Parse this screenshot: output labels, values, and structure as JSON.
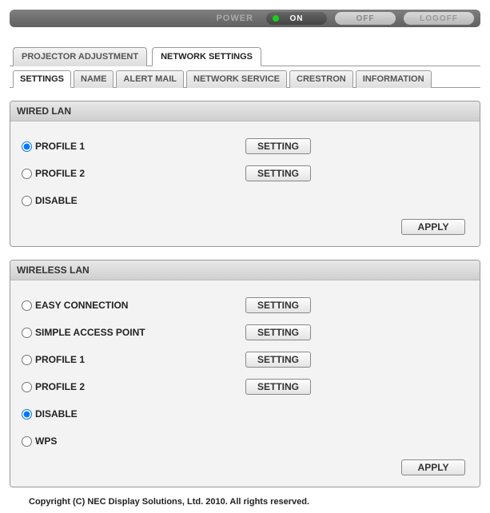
{
  "topbar": {
    "power_label": "POWER",
    "on_label": "ON",
    "off_label": "OFF",
    "logoff_label": "LOGOFF"
  },
  "main_tabs": {
    "projector_adjustment": "PROJECTOR ADJUSTMENT",
    "network_settings": "NETWORK SETTINGS"
  },
  "sub_tabs": {
    "settings": "SETTINGS",
    "name": "NAME",
    "alert_mail": "ALERT MAIL",
    "network_service": "NETWORK SERVICE",
    "crestron": "CRESTRON",
    "information": "INFORMATION"
  },
  "buttons": {
    "setting": "SETTING",
    "apply": "APPLY"
  },
  "wired_lan": {
    "title": "WIRED LAN",
    "options": {
      "profile1": "PROFILE 1",
      "profile2": "PROFILE 2",
      "disable": "DISABLE"
    },
    "selected": "profile1"
  },
  "wireless_lan": {
    "title": "WIRELESS LAN",
    "options": {
      "easy_connection": "EASY CONNECTION",
      "simple_access_point": "SIMPLE ACCESS POINT",
      "profile1": "PROFILE 1",
      "profile2": "PROFILE 2",
      "disable": "DISABLE",
      "wps": "WPS"
    },
    "selected": "disable"
  },
  "footer": "Copyright (C) NEC Display Solutions, Ltd. 2010. All rights reserved."
}
